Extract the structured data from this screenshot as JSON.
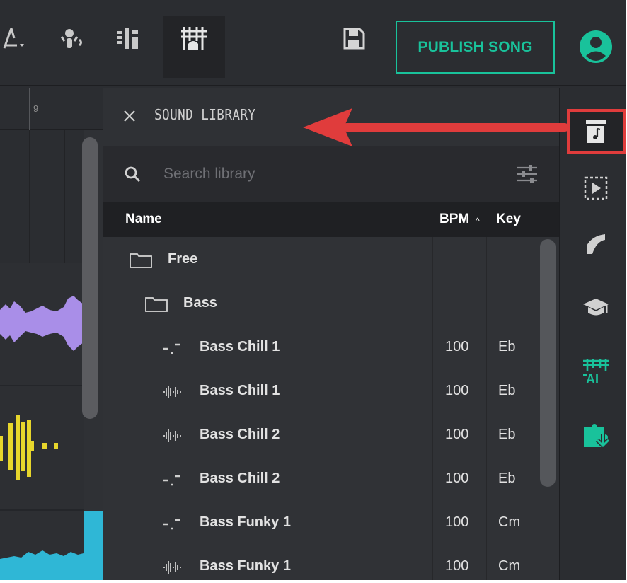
{
  "toolbar": {
    "publish_label": "PUBLISH SONG"
  },
  "tracks": {
    "ruler_number": "9"
  },
  "panel": {
    "title": "SOUND LIBRARY",
    "search_placeholder": "Search library",
    "columns": {
      "name": "Name",
      "bpm": "BPM",
      "key": "Key",
      "sort_indicator": "^"
    },
    "rows": [
      {
        "type": "folder",
        "name": "Free",
        "bpm": "",
        "key": "",
        "indent": 0
      },
      {
        "type": "folder",
        "name": "Bass",
        "bpm": "",
        "key": "",
        "indent": 1
      },
      {
        "type": "midi",
        "name": "Bass Chill 1",
        "bpm": "100",
        "key": "Eb",
        "indent": 2
      },
      {
        "type": "audio",
        "name": "Bass Chill 1",
        "bpm": "100",
        "key": "Eb",
        "indent": 2
      },
      {
        "type": "audio",
        "name": "Bass Chill 2",
        "bpm": "100",
        "key": "Eb",
        "indent": 2
      },
      {
        "type": "midi",
        "name": "Bass Chill 2",
        "bpm": "100",
        "key": "Eb",
        "indent": 2
      },
      {
        "type": "midi",
        "name": "Bass Funky 1",
        "bpm": "100",
        "key": "Cm",
        "indent": 2
      },
      {
        "type": "audio",
        "name": "Bass Funky 1",
        "bpm": "100",
        "key": "Cm",
        "indent": 2
      }
    ]
  },
  "icons": {
    "toolbar": [
      "tuner-icon",
      "mic-monitor-icon",
      "mixer-icon",
      "keyboard-icon",
      "save-icon",
      "account-icon"
    ],
    "sidebar": [
      "sound-library-icon",
      "loop-pack-icon",
      "guitar-icon",
      "learn-icon",
      "ai-icon",
      "plugin-icon"
    ]
  },
  "colors": {
    "accent": "#19c29b",
    "annotation": "#e03c3c",
    "waveform_purple": "#a98ee8",
    "waveform_yellow": "#e7d62c",
    "waveform_cyan": "#2fb7d6"
  }
}
